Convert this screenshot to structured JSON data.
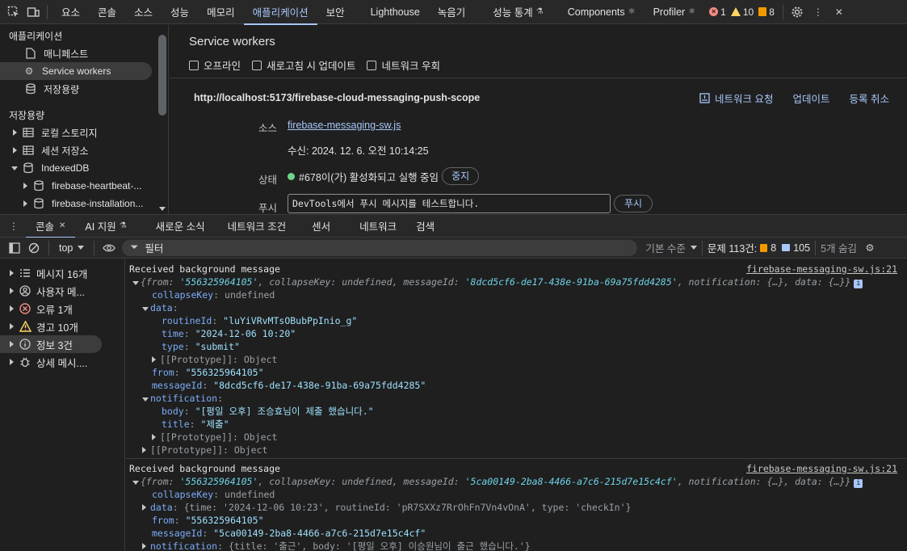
{
  "topbar": {
    "tabs": [
      "요소",
      "콘솔",
      "소스",
      "성능",
      "메모리",
      "애플리케이션",
      "보안",
      "Lighthouse",
      "녹음기",
      "성능 통계",
      "Components",
      "Profiler"
    ],
    "active_index": 5,
    "errors": "1",
    "warnings": "10",
    "issues": "8"
  },
  "app_sidebar": {
    "section1": "애플리케이션",
    "manifest": "매니페스트",
    "service_workers": "Service workers",
    "storage_item": "저장용량",
    "section2": "저장용량",
    "local_storage": "로컬 스토리지",
    "session_storage": "세션 저장소",
    "indexeddb": "IndexedDB",
    "db1": "firebase-heartbeat-...",
    "db2": "firebase-installation..."
  },
  "sw": {
    "title": "Service workers",
    "opt_offline": "오프라인",
    "opt_update": "새로고침 시 업데이트",
    "opt_bypass": "네트워크 우회",
    "scope": "http://localhost:5173/firebase-cloud-messaging-push-scope",
    "network_requests": "네트워크 요청",
    "update": "업데이트",
    "unregister": "등록 취소",
    "source_label": "소스",
    "source_file": "firebase-messaging-sw.js",
    "received": "수신: 2024. 12. 6. 오전 10:14:25",
    "status_label": "상태",
    "status_text": "#678이(가) 활성화되고 실행 중임",
    "stop_btn": "중지",
    "push_label": "푸시",
    "push_input": "DevTools에서 푸시 메시지를 테스트합니다.",
    "push_btn": "푸시"
  },
  "drawer": {
    "tabs": [
      "콘솔",
      "AI 지원",
      "새로운 소식",
      "네트워크 조건",
      "센서",
      "네트워크",
      "검색"
    ]
  },
  "console_toolbar": {
    "context": "top",
    "filter_placeholder": "필터",
    "levels": "기본 수준",
    "issues_label": "문제 113건:",
    "issues_warn": "8",
    "issues_info": "105",
    "hidden": "5개 숨김"
  },
  "console_sidebar": {
    "items": [
      "메시지 16개",
      "사용자 메...",
      "오류 1개",
      "경고 10개",
      "정보 3건",
      "상세 메시...."
    ]
  },
  "messages": [
    {
      "title": "Received background message",
      "source": "firebase-messaging-sw.js:21",
      "summary_from": "'556325964105'",
      "summary_msgid": "'8dcd5cf6-de17-438e-91ba-69a75fdd4285'",
      "collapse_key": "collapseKey",
      "undefined_text": "undefined",
      "routine_id": "\"luYiVRvMTsOBubPpInio_g\"",
      "time": "\"2024-12-06 10:20\"",
      "type": "\"submit\"",
      "from": "\"556325964105\"",
      "message_id": "\"8dcd5cf6-de17-438e-91ba-69a75fdd4285\"",
      "body": "\"[평일 오후] 조승효님이 제출 했습니다.\"",
      "title_val": "\"제출\""
    },
    {
      "title": "Received background message",
      "source": "firebase-messaging-sw.js:21",
      "summary_from": "'556325964105'",
      "summary_msgid": "'5ca00149-2ba8-4466-a7c6-215d7e15c4cf'",
      "data_inline": "{time: '2024-12-06 10:23', routineId: 'pR7SXXz7RrOhFn7Vn4vOnA', type: 'checkIn'}",
      "from": "\"556325964105\"",
      "message_id": "\"5ca00149-2ba8-4466-a7c6-215d7e15c4cf\"",
      "notification_inline": "{title: '출근', body: '[평일 오후] 이승원님이 출근 했습니다.'}"
    }
  ]
}
